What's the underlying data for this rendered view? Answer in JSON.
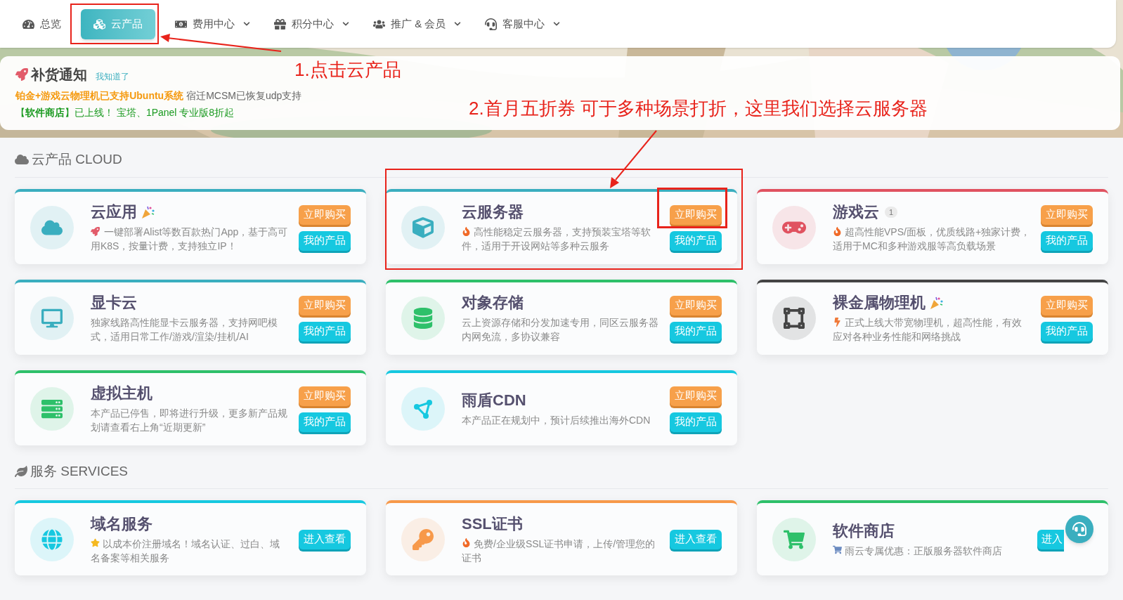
{
  "nav": [
    {
      "label": "总览",
      "selected": false,
      "dropdown": false
    },
    {
      "label": "云产品",
      "selected": true,
      "dropdown": false
    },
    {
      "label": "费用中心",
      "selected": false,
      "dropdown": true
    },
    {
      "label": "积分中心",
      "selected": false,
      "dropdown": true
    },
    {
      "label": "推广 & 会员",
      "selected": false,
      "dropdown": true
    },
    {
      "label": "客服中心",
      "selected": false,
      "dropdown": true
    }
  ],
  "notice": {
    "title": "补货通知",
    "dismiss": "我知道了",
    "line1_highlight": "铂金+游戏云物理机已支持Ubuntu系统",
    "line1_rest": "宿迁MCSM已恢复udp支持",
    "line2": "【**软件商店**】已上线！ 宝塔、1Panel 专业版8折起"
  },
  "sections": [
    {
      "title": "云产品 CLOUD",
      "cards": [
        {
          "title": "云应用",
          "color": "#3aaebf",
          "desc": "一键部署Alist等数百款热门App，基于高可用K8S，按量计费，支持独立IP！",
          "buttons": [
            {
              "label": "立即购买",
              "kind": "buy"
            },
            {
              "label": "我的产品",
              "kind": "mine"
            }
          ]
        },
        {
          "title": "云服务器",
          "color": "#3aaebf",
          "desc": "高性能稳定云服务器，支持预装宝塔等软件，适用于开设网站等多种云服务",
          "buttons": [
            {
              "label": "立即购买",
              "kind": "buy"
            },
            {
              "label": "我的产品",
              "kind": "mine"
            }
          ]
        },
        {
          "title": "游戏云",
          "color": "#e05260",
          "badge": "1",
          "desc": "超高性能VPS/面板，优质线路+独家计费，适用于MC和多种游戏服等高负载场景",
          "buttons": [
            {
              "label": "立即购买",
              "kind": "buy"
            },
            {
              "label": "我的产品",
              "kind": "mine"
            }
          ]
        },
        {
          "title": "显卡云",
          "color": "#3aaebf",
          "desc": "独家线路高性能显卡云服务器，支持网吧模式，适用日常工作/游戏/渲染/挂机/AI",
          "buttons": [
            {
              "label": "立即购买",
              "kind": "buy"
            },
            {
              "label": "我的产品",
              "kind": "mine"
            }
          ]
        },
        {
          "title": "对象存储",
          "color": "#2ec06a",
          "desc": "云上资源存储和分发加速专用，同区云服务器内网免流，多协议兼容",
          "buttons": [
            {
              "label": "立即购买",
              "kind": "buy"
            },
            {
              "label": "我的产品",
              "kind": "mine"
            }
          ]
        },
        {
          "title": "裸金属物理机",
          "color": "#444444",
          "desc": "正式上线大带宽物理机，超高性能，有效应对各种业务性能和网络挑战",
          "buttons": [
            {
              "label": "立即购买",
              "kind": "buy"
            },
            {
              "label": "我的产品",
              "kind": "mine"
            }
          ]
        },
        {
          "title": "虚拟主机",
          "color": "#2ec06a",
          "desc": "本产品已停售，即将进行升级，更多新产品规划请查看右上角“近期更新”",
          "buttons": [
            {
              "label": "立即购买",
              "kind": "buy"
            },
            {
              "label": "我的产品",
              "kind": "mine"
            }
          ]
        },
        {
          "title": "雨盾CDN",
          "color": "#16c8e0",
          "desc": "本产品正在规划中，预计后续推出海外CDN",
          "buttons": [
            {
              "label": "立即购买",
              "kind": "buy"
            },
            {
              "label": "我的产品",
              "kind": "mine"
            }
          ]
        }
      ]
    },
    {
      "title": "服务 SERVICES",
      "cards": [
        {
          "title": "域名服务",
          "color": "#16c8e0",
          "desc": "以成本价注册域名！域名认证、过白、域名备案等相关服务",
          "buttons": [
            {
              "label": "进入查看",
              "kind": "mine"
            }
          ]
        },
        {
          "title": "SSL证书",
          "color": "#f7994a",
          "desc": "免费/企业级SSL证书申请，上传/管理您的证书",
          "buttons": [
            {
              "label": "进入查看",
              "kind": "mine"
            }
          ]
        },
        {
          "title": "软件商店",
          "color": "#2ec06a",
          "desc": "雨云专属优惠：正版服务器软件商店",
          "buttons": [
            {
              "label": "进入",
              "kind": "mine"
            }
          ]
        }
      ]
    }
  ],
  "annotations": [
    {
      "text": "1.点击云产品"
    },
    {
      "text": "2.首月五折券 可于多种场景打折，这里我们选择云服务器"
    }
  ]
}
